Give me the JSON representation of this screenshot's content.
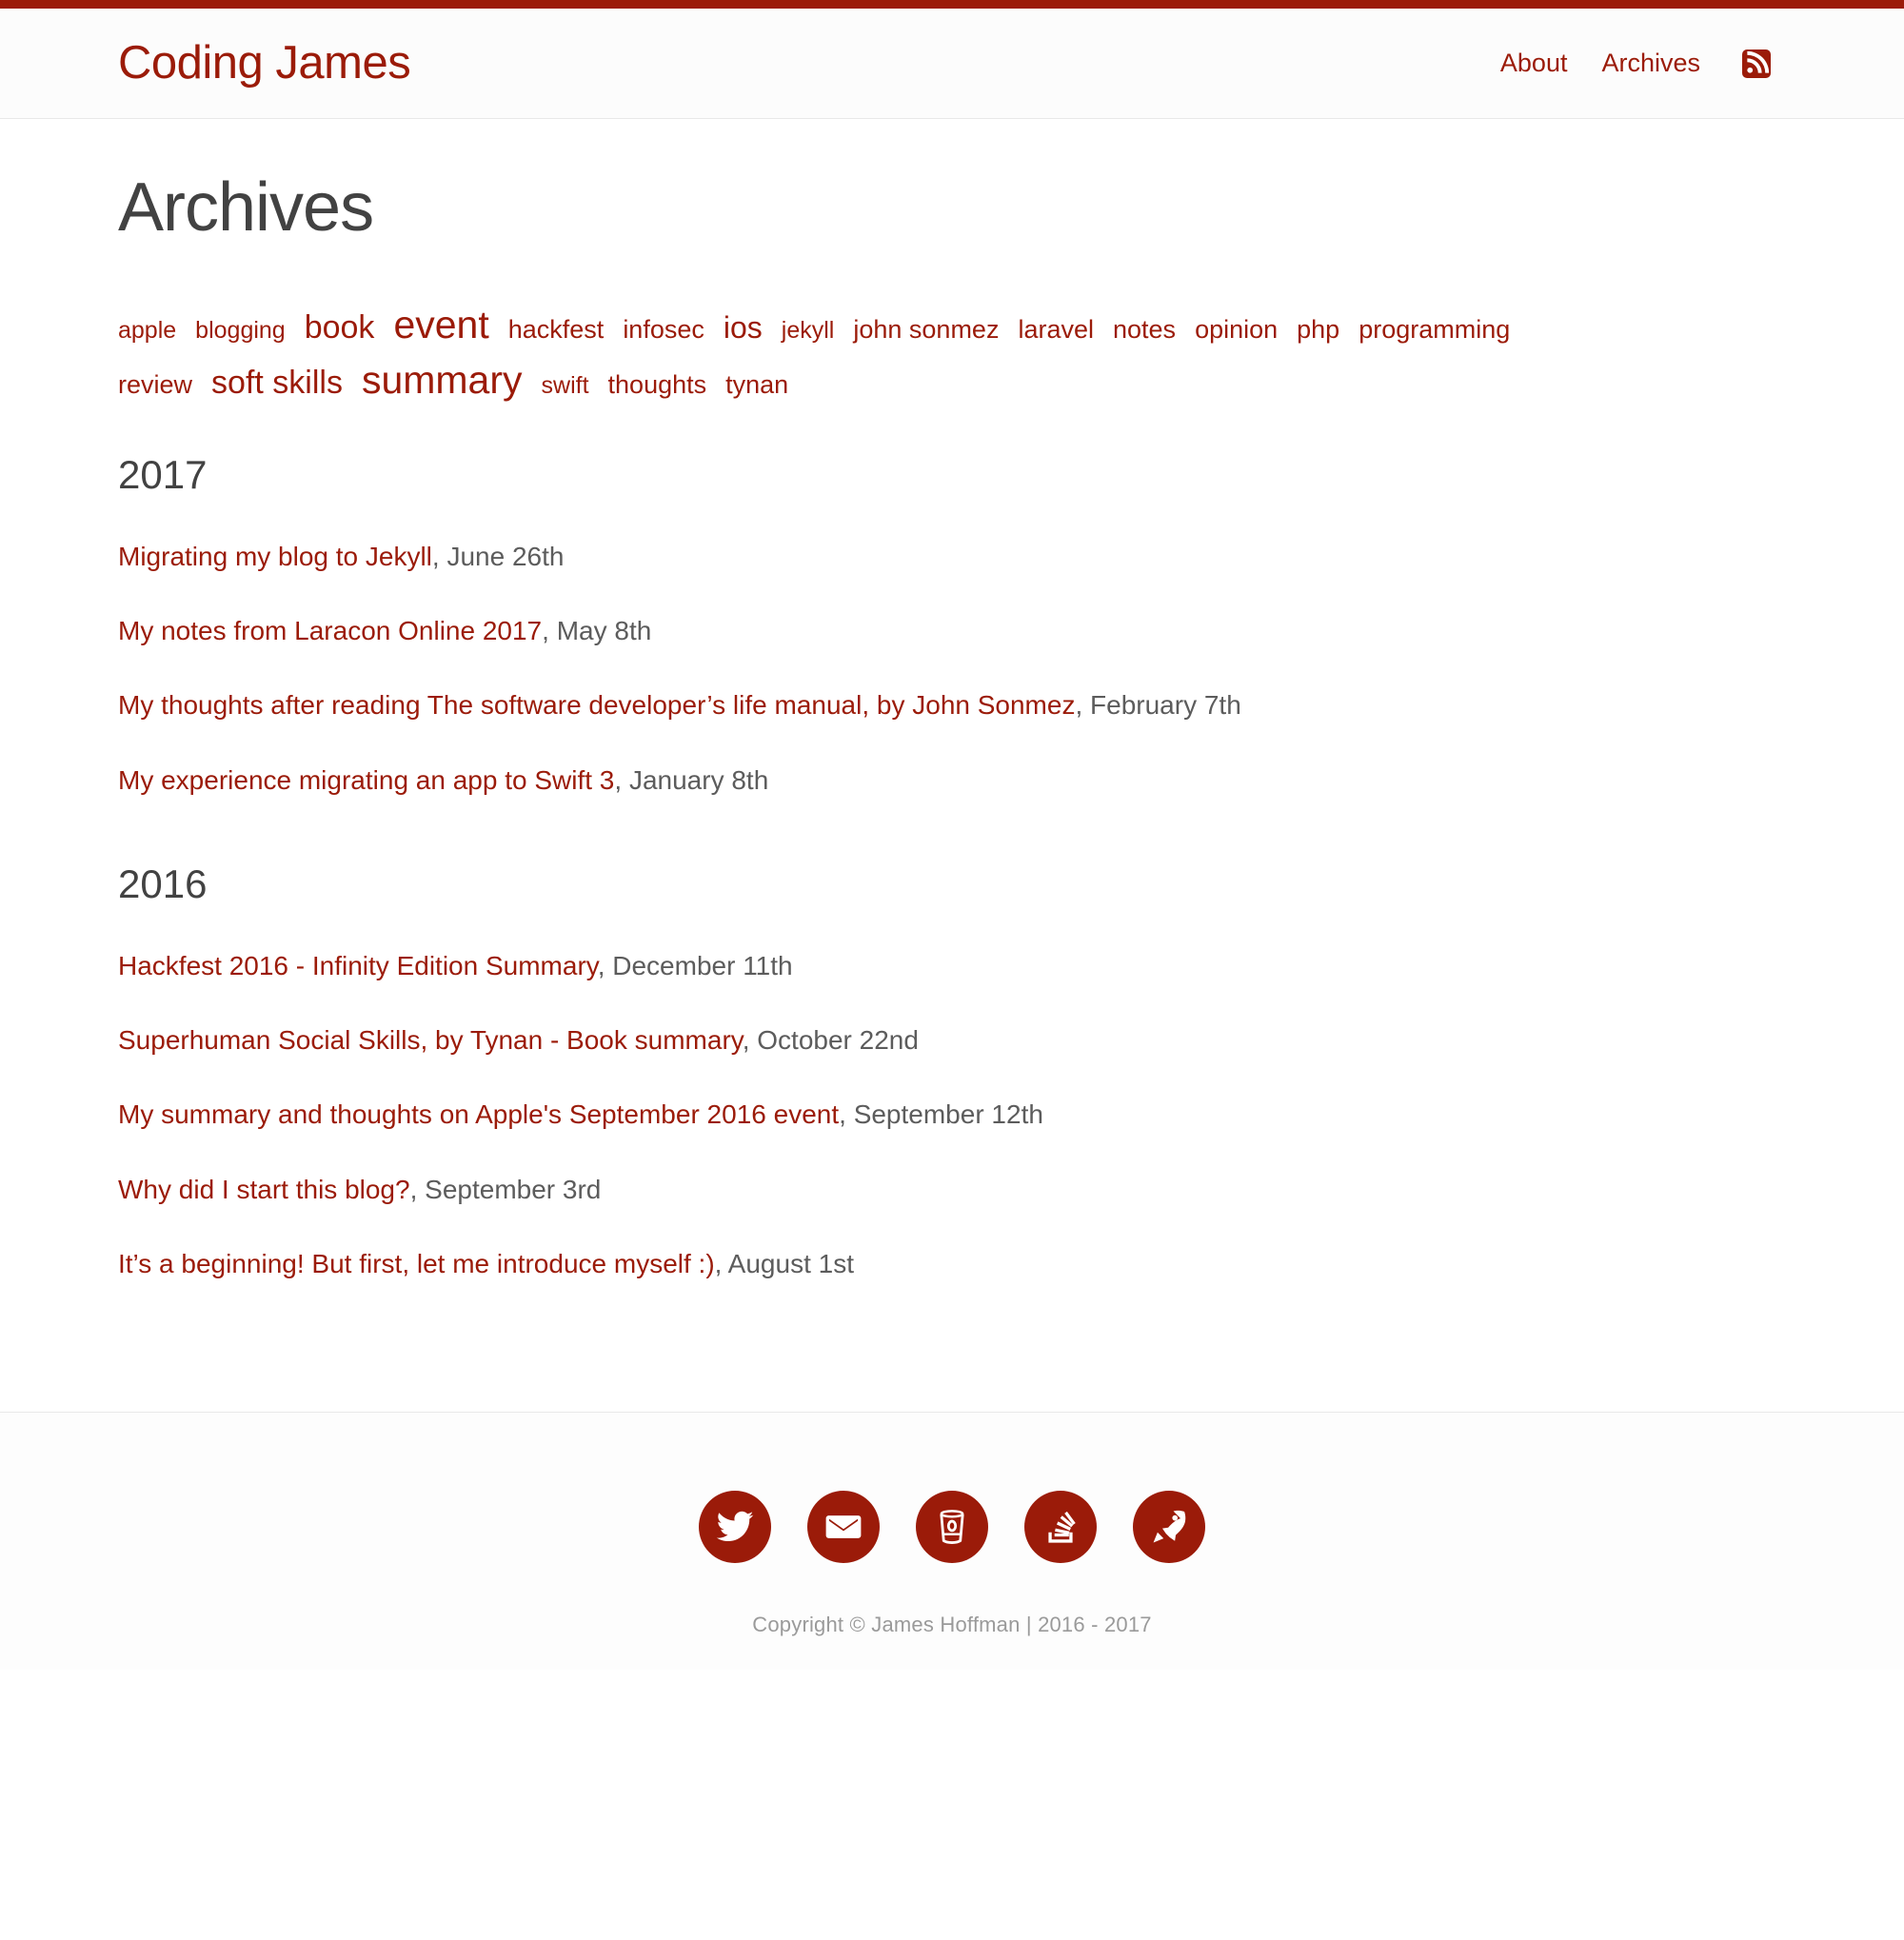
{
  "theme": {
    "accent": "#9b1b09",
    "text_dark": "#424242",
    "text_muted": "#5c5c5c",
    "footer_text": "#9a9a9a",
    "page_bg": "#ffffff",
    "header_bg": "#fcfcfc",
    "border": "#e8e8e8"
  },
  "header": {
    "site_title": "Coding James",
    "nav": [
      {
        "label": "About",
        "name": "nav-link-about"
      },
      {
        "label": "Archives",
        "name": "nav-link-archives"
      }
    ],
    "rss_icon": "rss-feed-icon"
  },
  "main": {
    "page_title": "Archives",
    "tags": [
      {
        "label": "apple",
        "size": 25
      },
      {
        "label": "blogging",
        "size": 25
      },
      {
        "label": "book",
        "size": 34
      },
      {
        "label": "event",
        "size": 41
      },
      {
        "label": "hackfest",
        "size": 27
      },
      {
        "label": "infosec",
        "size": 27
      },
      {
        "label": "ios",
        "size": 32
      },
      {
        "label": "jekyll",
        "size": 25
      },
      {
        "label": "john sonmez",
        "size": 27
      },
      {
        "label": "laravel",
        "size": 27
      },
      {
        "label": "notes",
        "size": 27
      },
      {
        "label": "opinion",
        "size": 27
      },
      {
        "label": "php",
        "size": 27
      },
      {
        "label": "programming",
        "size": 27
      },
      {
        "label": "review",
        "size": 27
      },
      {
        "label": "soft skills",
        "size": 34
      },
      {
        "label": "summary",
        "size": 41
      },
      {
        "label": "swift",
        "size": 25
      },
      {
        "label": "thoughts",
        "size": 27
      },
      {
        "label": "tynan",
        "size": 27
      }
    ],
    "years": [
      {
        "year": "2017",
        "posts": [
          {
            "title": "Migrating my blog to Jekyll",
            "date": "June 26th"
          },
          {
            "title": "My notes from Laracon Online 2017",
            "date": "May 8th"
          },
          {
            "title": "My thoughts after reading The software developer’s life manual, by John Sonmez",
            "date": "February 7th"
          },
          {
            "title": "My experience migrating an app to Swift 3",
            "date": "January 8th"
          }
        ]
      },
      {
        "year": "2016",
        "posts": [
          {
            "title": "Hackfest 2016 - Infinity Edition Summary",
            "date": "December 11th"
          },
          {
            "title": "Superhuman Social Skills, by Tynan - Book summary",
            "date": "October 22nd"
          },
          {
            "title": "My summary and thoughts on Apple's September 2016 event",
            "date": "September 12th"
          },
          {
            "title": "Why did I start this blog?",
            "date": "September 3rd"
          },
          {
            "title": "It’s a beginning! But first, let me introduce myself :)",
            "date": "August 1st"
          }
        ]
      }
    ],
    "date_separator": ", "
  },
  "footer": {
    "social": [
      {
        "name": "twitter-icon",
        "label": "Twitter"
      },
      {
        "name": "email-icon",
        "label": "Email"
      },
      {
        "name": "coffee-cup-icon",
        "label": "Coffee"
      },
      {
        "name": "stack-overflow-icon",
        "label": "Stack Overflow"
      },
      {
        "name": "rocket-icon",
        "label": "Rocket"
      }
    ],
    "copyright": "Copyright © James Hoffman | 2016 - 2017"
  }
}
